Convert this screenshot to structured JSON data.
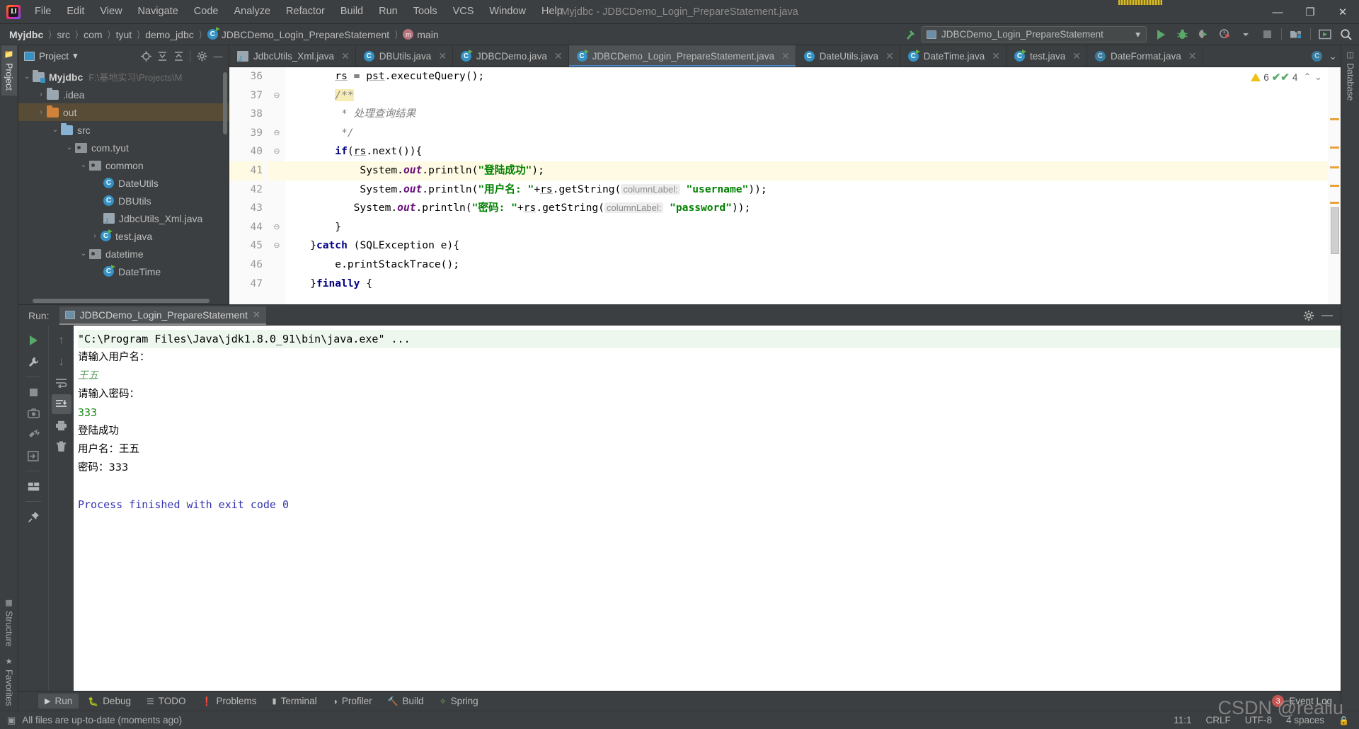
{
  "window": {
    "title": "Myjdbc - JDBCDemo_Login_PrepareStatement.java",
    "minimize": "—",
    "maximize": "❐",
    "close": "✕"
  },
  "menubar": [
    {
      "label": "File"
    },
    {
      "label": "Edit"
    },
    {
      "label": "View"
    },
    {
      "label": "Navigate"
    },
    {
      "label": "Code"
    },
    {
      "label": "Analyze"
    },
    {
      "label": "Refactor"
    },
    {
      "label": "Build"
    },
    {
      "label": "Run"
    },
    {
      "label": "Tools"
    },
    {
      "label": "VCS"
    },
    {
      "label": "Window"
    },
    {
      "label": "Help"
    }
  ],
  "breadcrumb": [
    {
      "label": "Myjdbc",
      "icon": ""
    },
    {
      "label": "src",
      "icon": ""
    },
    {
      "label": "com",
      "icon": ""
    },
    {
      "label": "tyut",
      "icon": ""
    },
    {
      "label": "demo_jdbc",
      "icon": ""
    },
    {
      "label": "JDBCDemo_Login_PrepareStatement",
      "icon": "class-icon"
    },
    {
      "label": "main",
      "icon": "method-icon"
    }
  ],
  "run_config": {
    "name": "JDBCDemo_Login_PrepareStatement",
    "dropdown_arrow": "▾"
  },
  "toolbar_buttons": [
    {
      "name": "run-button",
      "label": "Run"
    },
    {
      "name": "debug-button",
      "label": "Debug"
    },
    {
      "name": "run-coverage-button",
      "label": "Run with Coverage"
    },
    {
      "name": "profiler-button",
      "label": "Profiler"
    },
    {
      "name": "stop-button",
      "label": "Stop"
    },
    {
      "name": "project-structure-button",
      "label": "Project Structure"
    },
    {
      "name": "select-opened-file-button",
      "label": "Select Opened File"
    },
    {
      "name": "search-everywhere-button",
      "label": "Search Everywhere"
    }
  ],
  "left_tool_tabs": [
    {
      "label": "Project",
      "active": true
    },
    {
      "label": "Structure",
      "active": false
    },
    {
      "label": "Favorites",
      "active": false
    }
  ],
  "right_tool_tabs": [
    {
      "label": "Database",
      "active": false
    }
  ],
  "project_pane": {
    "title": "Project",
    "dropdown": "▾",
    "tools": [
      "locate-icon",
      "expand-all-icon",
      "collapse-all-icon",
      "settings-gear-icon",
      "hide-icon"
    ],
    "tree": [
      {
        "indent": 0,
        "arrow": "⌄",
        "icon": "module-folder-icon",
        "label": "Myjdbc",
        "bold": true,
        "path": "F:\\基地实习\\Projects\\M",
        "selected": false
      },
      {
        "indent": 1,
        "arrow": "›",
        "icon": "folder-icon",
        "label": ".idea",
        "bold": false,
        "path": "",
        "selected": false
      },
      {
        "indent": 1,
        "arrow": "›",
        "icon": "folder-orange-icon",
        "label": "out",
        "bold": false,
        "path": "",
        "selected": true
      },
      {
        "indent": 1,
        "arrow": "⌄",
        "icon": "folder-blue-icon",
        "label": "src",
        "bold": false,
        "path": "",
        "selected": false
      },
      {
        "indent": 2,
        "arrow": "⌄",
        "icon": "package-icon",
        "label": "com.tyut",
        "bold": false,
        "path": "",
        "selected": false
      },
      {
        "indent": 3,
        "arrow": "⌄",
        "icon": "package-icon",
        "label": "common",
        "bold": false,
        "path": "",
        "selected": false
      },
      {
        "indent": 4,
        "arrow": "",
        "icon": "class-icon",
        "label": "DateUtils",
        "bold": false,
        "path": "",
        "selected": false
      },
      {
        "indent": 4,
        "arrow": "",
        "icon": "class-icon",
        "label": "DBUtils",
        "bold": false,
        "path": "",
        "selected": false
      },
      {
        "indent": 4,
        "arrow": "",
        "icon": "xml-java-icon",
        "label": "JdbcUtils_Xml.java",
        "bold": false,
        "path": "",
        "selected": false
      },
      {
        "indent": 3,
        "arrow": "›",
        "icon": "runnable-class-icon",
        "label": "test.java",
        "bold": false,
        "path": "",
        "selected": false
      },
      {
        "indent": 3,
        "arrow": "⌄",
        "icon": "package-icon",
        "label": "datetime",
        "bold": false,
        "path": "",
        "selected": false
      },
      {
        "indent": 4,
        "arrow": "",
        "icon": "runnable-class-icon",
        "label": "DateTime",
        "bold": false,
        "path": "",
        "selected": false
      }
    ]
  },
  "editor_tabs": [
    {
      "label": "JdbcUtils_Xml.java",
      "icon": "xml-java-icon",
      "active": false
    },
    {
      "label": "DBUtils.java",
      "icon": "class-icon",
      "active": false
    },
    {
      "label": "JDBCDemo.java",
      "icon": "runnable-class-icon",
      "active": false
    },
    {
      "label": "JDBCDemo_Login_PrepareStatement.java",
      "icon": "runnable-class-icon",
      "active": true
    },
    {
      "label": "DateUtils.java",
      "icon": "class-icon",
      "active": false
    },
    {
      "label": "DateTime.java",
      "icon": "runnable-class-icon",
      "active": false
    },
    {
      "label": "test.java",
      "icon": "runnable-class-icon",
      "active": false
    },
    {
      "label": "DateFormat.java",
      "icon": "locked-class-icon",
      "active": false
    }
  ],
  "editor_tabs_overflow": "⌄",
  "inspection_widget": {
    "warning_count": "6",
    "check_count": "4",
    "up_arrow": "⌃",
    "down_arrow": "⌄"
  },
  "code": {
    "first_line_number": 36,
    "lines": [
      {
        "num": "36",
        "fold": "",
        "highlight": false,
        "text": "        rs = pst.executeQuery();"
      },
      {
        "num": "37",
        "fold": "⊖",
        "highlight": false,
        "text": "        /**"
      },
      {
        "num": "38",
        "fold": "",
        "highlight": false,
        "text": "         * 处理查询结果"
      },
      {
        "num": "39",
        "fold": "⊖",
        "highlight": false,
        "text": "         */"
      },
      {
        "num": "40",
        "fold": "⊖",
        "highlight": false,
        "text": "        if(rs.next()){"
      },
      {
        "num": "41",
        "fold": "",
        "highlight": true,
        "text": "            System.out.println(\"登陆成功\");"
      },
      {
        "num": "42",
        "fold": "",
        "highlight": false,
        "text": "            System.out.println(\"用户名: \"+rs.getString( columnLabel: \"username\"));"
      },
      {
        "num": "43",
        "fold": "",
        "highlight": false,
        "text": "           System.out.println(\"密码: \"+rs.getString( columnLabel: \"password\"));"
      },
      {
        "num": "44",
        "fold": "⊖",
        "highlight": false,
        "text": "        }"
      },
      {
        "num": "45",
        "fold": "⊖",
        "highlight": false,
        "text": "    }catch (SQLException e){"
      },
      {
        "num": "46",
        "fold": "",
        "highlight": false,
        "text": "        e.printStackTrace();"
      },
      {
        "num": "47",
        "fold": "",
        "highlight": false,
        "text": "    }finally {"
      }
    ]
  },
  "run_panel": {
    "label": "Run:",
    "tab_name": "JDBCDemo_Login_PrepareStatement",
    "close": "✕",
    "header_tools": [
      "settings-gear-icon",
      "hide-icon"
    ],
    "toolbar_left": [
      {
        "name": "rerun-button",
        "label": "Rerun"
      },
      {
        "name": "edit-configuration-button",
        "label": "Edit Configuration"
      },
      {
        "name": "stop-button",
        "label": "Stop"
      },
      {
        "name": "screenshot-button",
        "label": "Screenshot"
      },
      {
        "name": "dump-threads-button",
        "label": "Dump Threads"
      },
      {
        "name": "attach-button",
        "label": "Attach"
      },
      {
        "name": "layout-button",
        "label": "Layout Settings"
      },
      {
        "name": "pin-button",
        "label": "Pin Tab"
      }
    ],
    "toolbar_right": [
      {
        "name": "up-the-stack-trace-button",
        "label": "Up the Stack Trace"
      },
      {
        "name": "down-the-stack-trace-button",
        "label": "Down the Stack Trace"
      },
      {
        "name": "soft-wrap-button",
        "label": "Soft-Wrap"
      },
      {
        "name": "scroll-to-end-button",
        "label": "Scroll to End"
      },
      {
        "name": "print-button",
        "label": "Print"
      },
      {
        "name": "clear-all-button",
        "label": "Clear All"
      }
    ],
    "console": [
      {
        "text": "\"C:\\Program Files\\Java\\jdk1.8.0_91\\bin\\java.exe\" ...",
        "style": "cmd"
      },
      {
        "text": "请输入用户名：",
        "style": "plain"
      },
      {
        "text": "王五",
        "style": "input"
      },
      {
        "text": "请输入密码：",
        "style": "plain"
      },
      {
        "text": "333",
        "style": "input-num"
      },
      {
        "text": "登陆成功",
        "style": "plain"
      },
      {
        "text": "用户名：王五",
        "style": "plain"
      },
      {
        "text": "密码：333",
        "style": "plain"
      },
      {
        "text": "",
        "style": "plain"
      },
      {
        "text": "Process finished with exit code 0",
        "style": "blue"
      }
    ]
  },
  "bottom_bar": [
    {
      "label": "Run",
      "icon": "play-icon",
      "active": true
    },
    {
      "label": "Debug",
      "icon": "bug-icon",
      "active": false
    },
    {
      "label": "TODO",
      "icon": "list-icon",
      "active": false
    },
    {
      "label": "Problems",
      "icon": "problems-icon",
      "active": false
    },
    {
      "label": "Terminal",
      "icon": "terminal-icon",
      "active": false
    },
    {
      "label": "Profiler",
      "icon": "profiler-icon",
      "active": false
    },
    {
      "label": "Build",
      "icon": "hammer-icon",
      "active": false
    },
    {
      "label": "Spring",
      "icon": "leaf-icon",
      "active": false
    }
  ],
  "event_log": {
    "label": "Event Log",
    "count": "3"
  },
  "status_bar": {
    "message": "All files are up-to-date (moments ago)",
    "caret": "11:1",
    "line_sep": "CRLF",
    "encoding": "UTF-8",
    "indent": "4 spaces",
    "lock": "🔒"
  },
  "watermark": "CSDN @realiu",
  "colors": {
    "accent": "#4a88c7",
    "selection": "#584c36",
    "highlight_line": "#fffae3",
    "green_run": "#59a869",
    "warning": "#edc215",
    "error_badge": "#c75450"
  }
}
